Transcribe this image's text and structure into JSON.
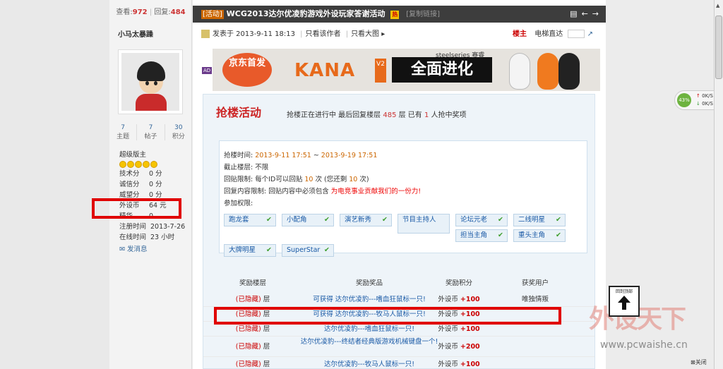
{
  "sidebar": {
    "views_label": "查看:",
    "views": "972",
    "replies_label": "回复:",
    "replies": "484",
    "username": "小马太暴躁",
    "stats": [
      {
        "value": "7",
        "label": "主题"
      },
      {
        "value": "7",
        "label": "帖子"
      },
      {
        "value": "30",
        "label": "积分"
      }
    ],
    "rank": "超级版主",
    "fields": [
      {
        "k": "技术分",
        "v": "0 分"
      },
      {
        "k": "诚信分",
        "v": "0 分"
      },
      {
        "k": "威望分",
        "v": "0 分"
      },
      {
        "k": "外设币",
        "v": "64 元"
      },
      {
        "k": "精华",
        "v": "0"
      },
      {
        "k": "注册时间",
        "v": "2013-7-26"
      },
      {
        "k": "在线时间",
        "v": "23 小时"
      }
    ],
    "message": "发消息"
  },
  "thread": {
    "tag": "[活动]",
    "title": "WCG2013达尔优凌豹游戏外设玩家答谢活动",
    "hot": "热",
    "copy_link": "[复制链接]",
    "posted": "发表于 2013-9-11 18:13",
    "only_author": "只看该作者",
    "big_image": "只看大图",
    "owner": "楼主",
    "elevator": "电梯直达"
  },
  "banner": {
    "ad": "AD",
    "jd": "京东首发",
    "kana": "KANA",
    "v2": "V2",
    "slogan": "全面进化",
    "brand": "steelseries 赛睿"
  },
  "panel": {
    "title": "抢楼活动",
    "desc_a": "抢楼正在进行中  最后回复楼层 ",
    "desc_floor": "485",
    "desc_b": " 层 已有 ",
    "desc_count": "1",
    "desc_c": " 人抢中奖项",
    "time_label": "抢楼时间: ",
    "time_start": "2013-9-11 17:51",
    "time_sep": " ~ ",
    "time_end": "2013-9-19 17:51",
    "deadline": "截止楼层: 不限",
    "reply_limit_a": "回贴限制: 每个ID可以回贴 ",
    "reply_limit_n": "10",
    "reply_limit_b": " 次 (您还剩 ",
    "reply_limit_m": "10",
    "reply_limit_c": " 次)",
    "content_limit_a": "回复内容限制: 回贴内容中必须包含 ",
    "content_limit_b": "为电竞事业贡献我们的一份力!",
    "perm_label": "参加权限:",
    "chips": [
      "跑龙套",
      "小配角",
      "演艺新秀",
      "节目主持人",
      "论坛元老",
      "二线明星",
      "担当主角",
      "重头主角",
      "大牌明星",
      "SuperStar"
    ],
    "headers": [
      "奖励楼层",
      "奖励奖品",
      "奖励积分",
      "获奖用户"
    ],
    "rows": [
      {
        "floor": "(已隐藏)",
        "unit": "层",
        "prize": "可获得 达尔优凌豹---嗜血狂鼠标一只!",
        "cur": "外设币",
        "pts": "+100",
        "winner": "唯独情叛"
      },
      {
        "floor": "(已隐藏)",
        "unit": "层",
        "prize": "可获得 达尔优凌豹---牧马人鼠标一只!",
        "cur": "外设币",
        "pts": "+100",
        "winner": ""
      },
      {
        "floor": "(已隐藏)",
        "unit": "层",
        "prize": "达尔优凌豹---嗜血狂鼠标一只!",
        "cur": "外设币",
        "pts": "+100",
        "winner": ""
      },
      {
        "floor": "(已隐藏)",
        "unit": "层",
        "prize": "达尔优凌豹---终结者经典版游戏机械键盘一个!",
        "cur": "外设币",
        "pts": "+200",
        "winner": ""
      },
      {
        "floor": "(已隐藏)",
        "unit": "层",
        "prize": "达尔优凌豹---牧马人鼠标一只!",
        "cur": "外设币",
        "pts": "+100",
        "winner": ""
      }
    ]
  },
  "overlay": {
    "top_label": "回到顶部",
    "watermark": "外设天下",
    "url": "www.pcwaishe.cn",
    "close": "关闭",
    "net_pct": "43%",
    "net_up": "0K/S",
    "net_down": "0K/S"
  }
}
